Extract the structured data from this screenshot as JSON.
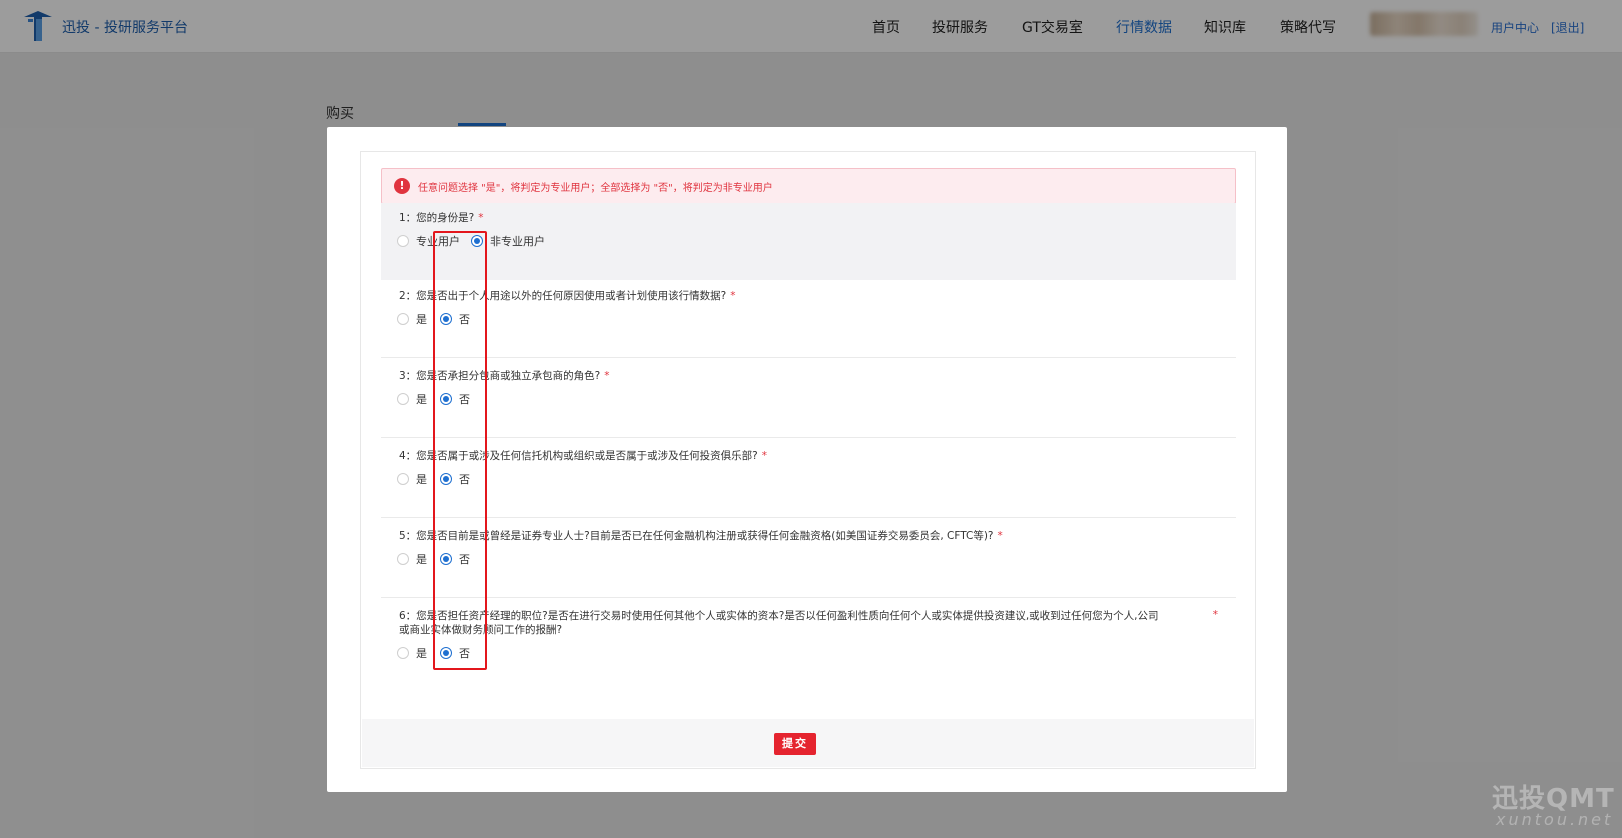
{
  "header": {
    "brand": "迅投 - 投研服务平台",
    "nav": [
      "首页",
      "投研服务",
      "GT交易室",
      "行情数据",
      "知识库",
      "策略代写"
    ],
    "active_nav": "行情数据",
    "user_center": "用户中心",
    "logout": "[退出]"
  },
  "page": {
    "title": "购买"
  },
  "alert": {
    "text": "任意问题选择 \"是\"，将判定为专业用户；全部选择为 \"否\"，将判定为非专业用户"
  },
  "questions": [
    {
      "label": "1：您的身份是?",
      "options": [
        "专业用户",
        "非专业用户"
      ],
      "selected": "非专业用户"
    },
    {
      "label": "2：您是否出于个人用途以外的任何原因使用或者计划使用该行情数据?",
      "options": [
        "是",
        "否"
      ],
      "selected": "否"
    },
    {
      "label": "3：您是否承担分包商或独立承包商的角色?",
      "options": [
        "是",
        "否"
      ],
      "selected": "否"
    },
    {
      "label": "4：您是否属于或涉及任何信托机构或组织或是否属于或涉及任何投资俱乐部?",
      "options": [
        "是",
        "否"
      ],
      "selected": "否"
    },
    {
      "label": "5：您是否目前是或曾经是证券专业人士?目前是否已在任何金融机构注册或获得任何金融资格(如美国证券交易委员会, CFTC等)?",
      "options": [
        "是",
        "否"
      ],
      "selected": "否"
    },
    {
      "label_line1": "6：您是否担任资产经理的职位?是否在进行交易时使用任何其他个人或实体的资本?是否以任何盈利性质向任何个人或实体提供投资建议,或收到过任何您为个人,公司",
      "label_line2": "或商业实体做财务顾问工作的报酬?",
      "options": [
        "是",
        "否"
      ],
      "selected": "否"
    }
  ],
  "required_mark": "*",
  "submit_label": "提交",
  "watermark": {
    "main": "迅投QMT",
    "sub": "xuntou.net"
  },
  "colors": {
    "accent": "#1e6fd0",
    "danger": "#e0343f",
    "submit": "#e5242f"
  }
}
